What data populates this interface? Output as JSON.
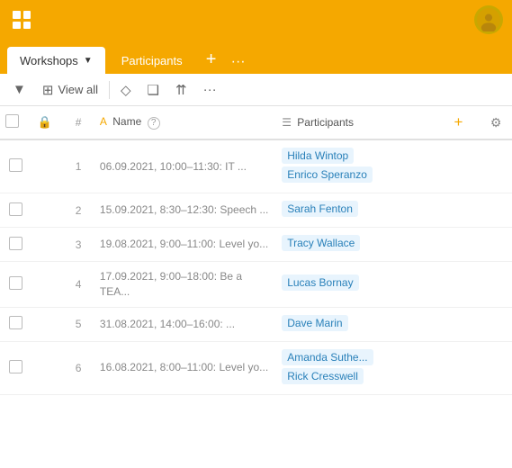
{
  "app": {
    "title": "Workshops",
    "tabs": [
      {
        "id": "workshops",
        "label": "Workshops",
        "active": true
      },
      {
        "id": "participants",
        "label": "Participants",
        "active": false
      }
    ],
    "tab_add_label": "+",
    "tab_more_label": "···"
  },
  "toolbar": {
    "view_all_label": "View all",
    "items": [
      {
        "id": "filter",
        "icon": "▼",
        "label": ""
      },
      {
        "id": "table",
        "icon": "⊞",
        "label": ""
      },
      {
        "id": "tag",
        "icon": "◇",
        "label": ""
      },
      {
        "id": "doc",
        "icon": "❑",
        "label": ""
      },
      {
        "id": "share",
        "icon": "⇈",
        "label": ""
      },
      {
        "id": "more",
        "icon": "···",
        "label": ""
      }
    ]
  },
  "table": {
    "columns": [
      {
        "id": "check",
        "label": ""
      },
      {
        "id": "lock",
        "label": "🔒"
      },
      {
        "id": "num",
        "label": "#"
      },
      {
        "id": "name",
        "label": "Name"
      },
      {
        "id": "participants",
        "label": "Participants"
      }
    ],
    "rows": [
      {
        "num": "1",
        "date": "06.09.2021, 10:00–11:30: IT ...",
        "participants": [
          "Hilda Wintop",
          "Enrico Speranzo"
        ]
      },
      {
        "num": "2",
        "date": "15.09.2021, 8:30–12:30: Speech ...",
        "participants": [
          "Sarah Fenton"
        ]
      },
      {
        "num": "3",
        "date": "19.08.2021, 9:00–11:00: Level yo...",
        "participants": [
          "Tracy Wallace"
        ]
      },
      {
        "num": "4",
        "date": "17.09.2021, 9:00–18:00: Be a TEA...",
        "participants": [
          "Lucas Bornay"
        ]
      },
      {
        "num": "5",
        "date": "31.08.2021, 14:00–16:00: ...",
        "participants": [
          "Dave Marin"
        ]
      },
      {
        "num": "6",
        "date": "16.08.2021, 8:00–11:00: Level yo...",
        "participants": [
          "Amanda Suthe...",
          "Rick Cresswell"
        ]
      }
    ]
  },
  "colors": {
    "primary": "#F5A800",
    "chip_bg": "#E8F4FD",
    "chip_text": "#2980b9"
  }
}
